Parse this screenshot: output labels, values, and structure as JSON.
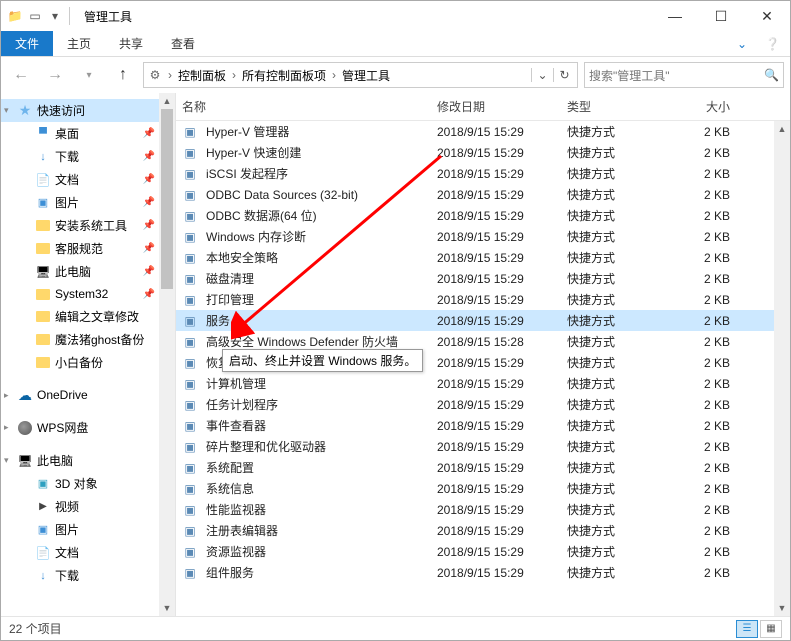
{
  "window": {
    "title": "管理工具"
  },
  "ribbon": {
    "file": "文件",
    "tabs": [
      "主页",
      "共享",
      "查看"
    ]
  },
  "breadcrumb": {
    "segments": [
      "控制面板",
      "所有控制面板项",
      "管理工具"
    ]
  },
  "search": {
    "placeholder": "搜索\"管理工具\""
  },
  "nav": {
    "quick_access": {
      "label": "快速访问",
      "items": [
        {
          "label": "桌面",
          "icon": "ic-desk",
          "pinned": true
        },
        {
          "label": "下载",
          "icon": "ic-down",
          "pinned": true
        },
        {
          "label": "文档",
          "icon": "ic-doc",
          "pinned": true
        },
        {
          "label": "图片",
          "icon": "ic-pic",
          "pinned": true
        },
        {
          "label": "安装系统工具",
          "icon": "ic-fold-y",
          "pinned": true
        },
        {
          "label": "客服规范",
          "icon": "ic-fold-y",
          "pinned": true
        },
        {
          "label": "此电脑",
          "icon": "ic-pc",
          "pinned": true
        },
        {
          "label": "System32",
          "icon": "ic-fold-y",
          "pinned": true
        },
        {
          "label": "编辑之文章修改",
          "icon": "ic-fold-y",
          "pinned": false
        },
        {
          "label": "魔法猪ghost备份",
          "icon": "ic-fold-y",
          "pinned": false
        },
        {
          "label": "小白备份",
          "icon": "ic-fold-y",
          "pinned": false
        }
      ]
    },
    "onedrive": {
      "label": "OneDrive"
    },
    "wps": {
      "label": "WPS网盘"
    },
    "this_pc": {
      "label": "此电脑",
      "items": [
        {
          "label": "3D 对象",
          "icon": "ic-3d"
        },
        {
          "label": "视频",
          "icon": "ic-vid"
        },
        {
          "label": "图片",
          "icon": "ic-pic"
        },
        {
          "label": "文档",
          "icon": "ic-doc"
        },
        {
          "label": "下载",
          "icon": "ic-down"
        }
      ]
    }
  },
  "columns": {
    "name": "名称",
    "date": "修改日期",
    "type": "类型",
    "size": "大小"
  },
  "files": [
    {
      "name": "Hyper-V 管理器",
      "date": "2018/9/15 15:29",
      "type": "快捷方式",
      "size": "2 KB"
    },
    {
      "name": "Hyper-V 快速创建",
      "date": "2018/9/15 15:29",
      "type": "快捷方式",
      "size": "2 KB"
    },
    {
      "name": "iSCSI 发起程序",
      "date": "2018/9/15 15:29",
      "type": "快捷方式",
      "size": "2 KB"
    },
    {
      "name": "ODBC Data Sources (32-bit)",
      "date": "2018/9/15 15:29",
      "type": "快捷方式",
      "size": "2 KB"
    },
    {
      "name": "ODBC 数据源(64 位)",
      "date": "2018/9/15 15:29",
      "type": "快捷方式",
      "size": "2 KB"
    },
    {
      "name": "Windows 内存诊断",
      "date": "2018/9/15 15:29",
      "type": "快捷方式",
      "size": "2 KB"
    },
    {
      "name": "本地安全策略",
      "date": "2018/9/15 15:29",
      "type": "快捷方式",
      "size": "2 KB"
    },
    {
      "name": "磁盘清理",
      "date": "2018/9/15 15:29",
      "type": "快捷方式",
      "size": "2 KB"
    },
    {
      "name": "打印管理",
      "date": "2018/9/15 15:29",
      "type": "快捷方式",
      "size": "2 KB"
    },
    {
      "name": "服务",
      "date": "2018/9/15 15:29",
      "type": "快捷方式",
      "size": "2 KB",
      "selected": true
    },
    {
      "name": "高级安全 Windows Defender 防火墙",
      "date": "2018/9/15 15:28",
      "type": "快捷方式",
      "size": "2 KB"
    },
    {
      "name": "恢复驱动器",
      "date": "2018/9/15 15:29",
      "type": "快捷方式",
      "size": "2 KB"
    },
    {
      "name": "计算机管理",
      "date": "2018/9/15 15:29",
      "type": "快捷方式",
      "size": "2 KB"
    },
    {
      "name": "任务计划程序",
      "date": "2018/9/15 15:29",
      "type": "快捷方式",
      "size": "2 KB"
    },
    {
      "name": "事件查看器",
      "date": "2018/9/15 15:29",
      "type": "快捷方式",
      "size": "2 KB"
    },
    {
      "name": "碎片整理和优化驱动器",
      "date": "2018/9/15 15:29",
      "type": "快捷方式",
      "size": "2 KB"
    },
    {
      "name": "系统配置",
      "date": "2018/9/15 15:29",
      "type": "快捷方式",
      "size": "2 KB"
    },
    {
      "name": "系统信息",
      "date": "2018/9/15 15:29",
      "type": "快捷方式",
      "size": "2 KB"
    },
    {
      "name": "性能监视器",
      "date": "2018/9/15 15:29",
      "type": "快捷方式",
      "size": "2 KB"
    },
    {
      "name": "注册表编辑器",
      "date": "2018/9/15 15:29",
      "type": "快捷方式",
      "size": "2 KB"
    },
    {
      "name": "资源监视器",
      "date": "2018/9/15 15:29",
      "type": "快捷方式",
      "size": "2 KB"
    },
    {
      "name": "组件服务",
      "date": "2018/9/15 15:29",
      "type": "快捷方式",
      "size": "2 KB"
    }
  ],
  "tooltip": "启动、终止并设置 Windows 服务。",
  "status": {
    "count": "22 个项目"
  }
}
